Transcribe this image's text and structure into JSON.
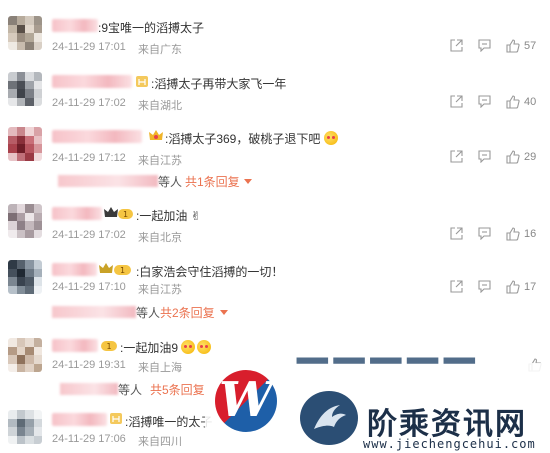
{
  "comments": [
    {
      "text": ":9宝唯一的滔搏太子",
      "time": "24-11-29 17:01",
      "location": "来自广东",
      "likes": "57"
    },
    {
      "text": ":滔搏太子再带大家飞一年",
      "time": "24-11-29 17:02",
      "location": "来自湖北",
      "likes": "40"
    },
    {
      "text": ":滔搏太子369，破桃子退下吧",
      "time": "24-11-29 17:12",
      "location": "来自江苏",
      "likes": "29",
      "reply": {
        "suffix": "等人",
        "link": "共1条回复"
      }
    },
    {
      "text": ":一起加油",
      "time": "24-11-29 17:02",
      "location": "来自北京",
      "likes": "16"
    },
    {
      "text": ":白家浩会守住滔搏的一切！",
      "time": "24-11-29 17:10",
      "location": "来自江苏",
      "likes": "17",
      "reply": {
        "suffix": "等人",
        "link": "共2条回复"
      }
    },
    {
      "text": ":一起加油9",
      "time": "24-11-29 19:31",
      "location": "来自上海",
      "likes": "",
      "reply": {
        "suffix": "等人",
        "link": "共5条回复"
      }
    },
    {
      "text": ":滔搏唯一的太子",
      "time": "24-11-29 17:06",
      "location": "来自四川",
      "likes": ""
    }
  ],
  "watermark": {
    "site_name": "阶乘资讯网",
    "url": "www.jiechengcehui.com"
  },
  "colors": {
    "accent": "#eb7350",
    "meta": "#999999",
    "text": "#333333"
  }
}
